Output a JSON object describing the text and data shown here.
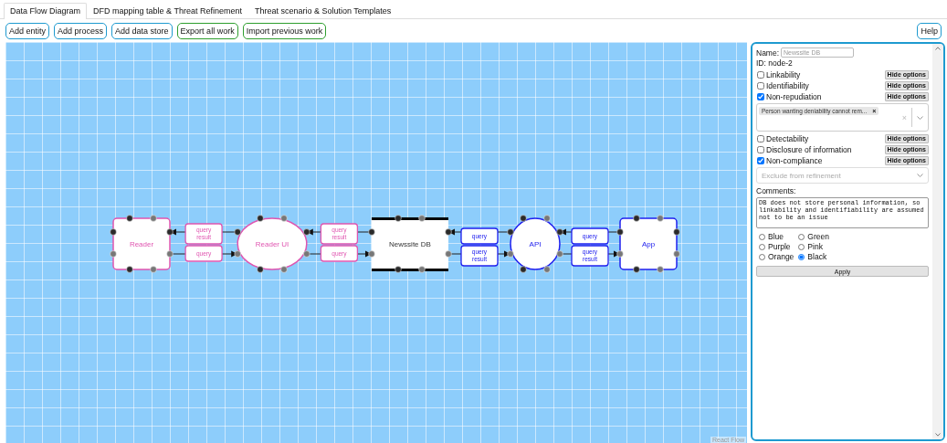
{
  "tabs": [
    {
      "label": "Data Flow Diagram",
      "selected": true
    },
    {
      "label": "DFD mapping table & Threat Refinement",
      "selected": false
    },
    {
      "label": "Threat scenario & Solution Templates",
      "selected": false
    }
  ],
  "toolbar": [
    {
      "label": "Add entity",
      "color": "#1e9ad0"
    },
    {
      "label": "Add process",
      "color": "#1e9ad0"
    },
    {
      "label": "Add data store",
      "color": "#1e9ad0"
    },
    {
      "label": "Export all work",
      "color": "#2e9e2e"
    },
    {
      "label": "Import previous work",
      "color": "#2e9e2e"
    }
  ],
  "help_button": {
    "label": "Help"
  },
  "diagram": {
    "nodes": [
      {
        "kind": "entity",
        "label": "Reader",
        "color": "#e055b0"
      },
      {
        "kind": "process",
        "label": "Reader UI",
        "color": "#e055b0"
      },
      {
        "kind": "datastore",
        "label": "Newssite DB",
        "color": "#000000"
      },
      {
        "kind": "process",
        "label": "API",
        "color": "#2020ee"
      },
      {
        "kind": "entity",
        "label": "App",
        "color": "#2020ee"
      }
    ],
    "links": [
      {
        "color": "#e055b0",
        "flows": [
          {
            "label": "query result",
            "leftward": true
          },
          {
            "label": "query",
            "leftward": false
          }
        ]
      },
      {
        "color": "#e055b0",
        "flows": [
          {
            "label": "query result",
            "leftward": true
          },
          {
            "label": "query",
            "leftward": false
          }
        ]
      },
      {
        "color": "#2020ee",
        "flows": [
          {
            "label": "query",
            "leftward": true
          },
          {
            "label": "query result",
            "leftward": false
          }
        ]
      },
      {
        "color": "#2020ee",
        "flows": [
          {
            "label": "query",
            "leftward": true
          },
          {
            "label": "query result",
            "leftward": false
          }
        ]
      }
    ],
    "attribution": "React Flow"
  },
  "panel": {
    "name_label": "Name:",
    "name_placeholder": "Newssite DB",
    "id_text": "ID: node-2",
    "threats": [
      {
        "label": "Linkability",
        "checked": false,
        "button": "Hide options"
      },
      {
        "label": "Identifiability",
        "checked": false,
        "button": "Hide options"
      },
      {
        "label": "Non-repudiation",
        "checked": true,
        "button": "Hide options",
        "select": {
          "kind": "multi",
          "chips": [
            {
              "label": "Person wanting deniability cannot rem...",
              "remove": "×"
            }
          ],
          "clear": "×"
        }
      },
      {
        "label": "Detectability",
        "checked": false,
        "button": "Hide options"
      },
      {
        "label": "Disclosure of information",
        "checked": false,
        "button": "Hide options"
      },
      {
        "label": "Non-compliance",
        "checked": true,
        "button": "Hide options",
        "select": {
          "kind": "single",
          "placeholder": "Exclude from refinement"
        }
      }
    ],
    "comments_label": "Comments:",
    "comments": "DB does not store personal information, so linkability and identifiability are assumed not to be an issue",
    "colors": [
      {
        "label": "Blue",
        "selected": false
      },
      {
        "label": "Green",
        "selected": false
      },
      {
        "label": "Purple",
        "selected": false
      },
      {
        "label": "Pink",
        "selected": false
      },
      {
        "label": "Orange",
        "selected": false
      },
      {
        "label": "Black",
        "selected": true
      }
    ],
    "apply": "Apply"
  }
}
